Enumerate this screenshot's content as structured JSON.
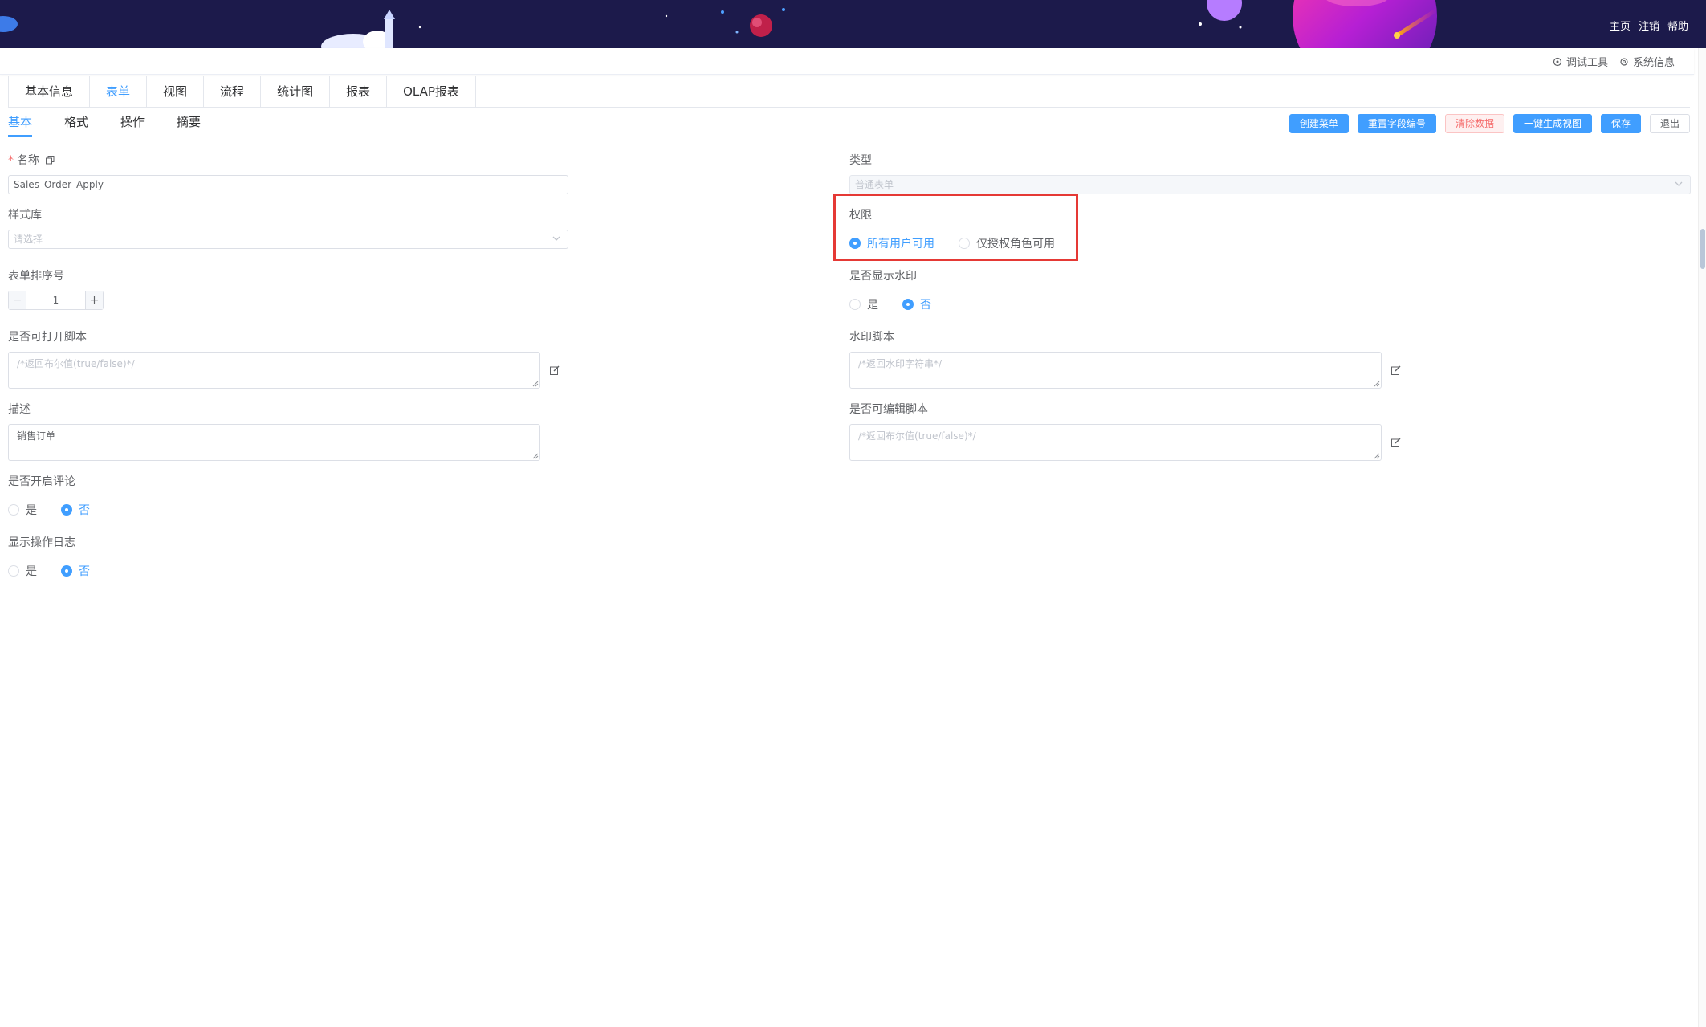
{
  "header": {
    "links": [
      "主页",
      "注销",
      "帮助"
    ]
  },
  "tools": {
    "debug": "调试工具",
    "sysinfo": "系统信息"
  },
  "main_tabs": [
    "基本信息",
    "表单",
    "视图",
    "流程",
    "统计图",
    "报表",
    "OLAP报表"
  ],
  "sub_tabs": [
    "基本",
    "格式",
    "操作",
    "摘要"
  ],
  "actions": {
    "create_menu": "创建菜单",
    "reset_field_no": "重置字段编号",
    "clear_data": "清除数据",
    "gen_view": "一键生成视图",
    "save": "保存",
    "exit": "退出"
  },
  "form": {
    "name_label": "名称",
    "name_value": "Sales_Order_Apply",
    "type_label": "类型",
    "type_value": "普通表单",
    "style_label": "样式库",
    "style_placeholder": "请选择",
    "perm_label": "权限",
    "perm_options": [
      "所有用户可用",
      "仅授权角色可用"
    ],
    "perm_selected": 0,
    "order_label": "表单排序号",
    "order_value": "1",
    "stepper_minus": "−",
    "stepper_plus": "+",
    "watermark_label": "是否显示水印",
    "yes": "是",
    "no": "否",
    "open_script_label": "是否可打开脚本",
    "open_script_placeholder": "/*返回布尔值(true/false)*/",
    "watermark_script_label": "水印脚本",
    "watermark_script_placeholder": "/*返回水印字符串*/",
    "desc_label": "描述",
    "desc_value": "销售订单",
    "edit_script_label": "是否可编辑脚本",
    "edit_script_placeholder": "/*返回布尔值(true/false)*/",
    "comment_label": "是否开启评论",
    "log_label": "显示操作日志"
  },
  "colors": {
    "primary": "#409eff",
    "banner": "#1c1a4b",
    "highlight": "#e53935",
    "danger": "#f56c6c"
  }
}
